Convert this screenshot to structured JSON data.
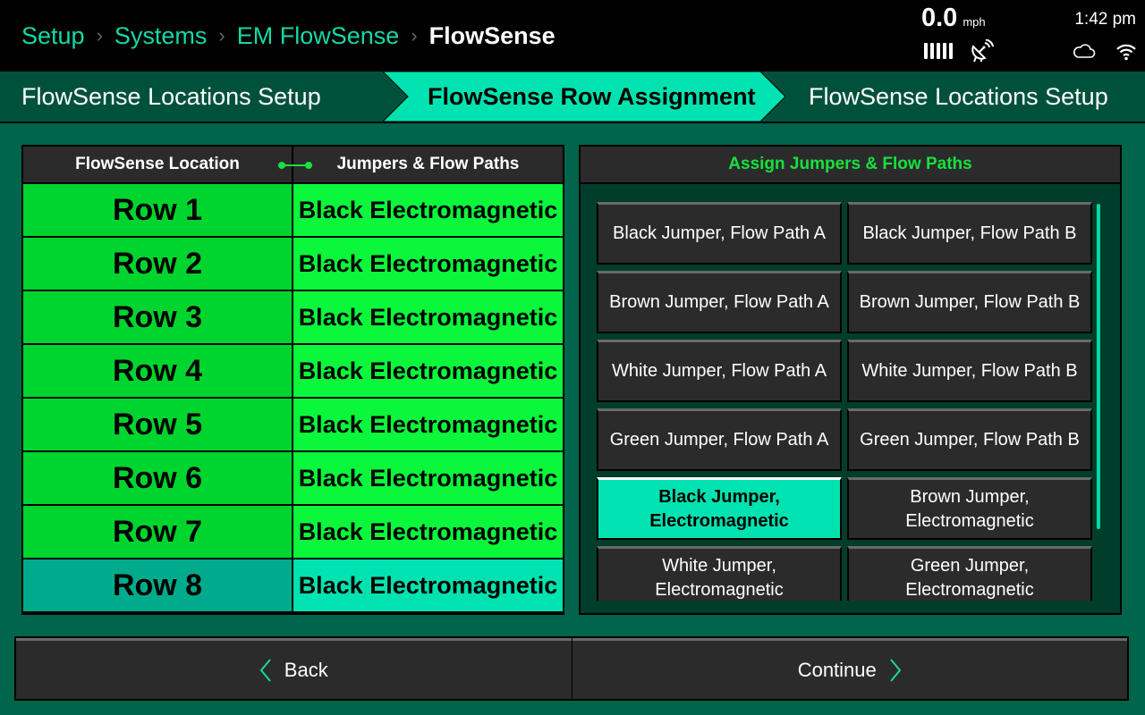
{
  "breadcrumb": {
    "items": [
      "Setup",
      "Systems",
      "EM FlowSense"
    ],
    "current": "FlowSense",
    "separator": "›"
  },
  "status": {
    "speed_value": "0.0",
    "speed_unit": "mph",
    "time": "1:42 pm",
    "icons": [
      "signal-bars-icon",
      "satellite-dish-icon",
      "cloud-icon",
      "wifi-icon"
    ]
  },
  "stepper": {
    "steps": [
      {
        "label": "FlowSense Locations Setup",
        "state": "previous"
      },
      {
        "label": "FlowSense Row Assignment",
        "state": "active"
      },
      {
        "label": "FlowSense Locations Setup",
        "state": "next"
      }
    ]
  },
  "table": {
    "headers": [
      "FlowSense Location",
      "Jumpers & Flow Paths"
    ],
    "rows": [
      {
        "location": "Row 1",
        "assignment": "Black Electromagnetic"
      },
      {
        "location": "Row 2",
        "assignment": "Black Electromagnetic"
      },
      {
        "location": "Row 3",
        "assignment": "Black Electromagnetic"
      },
      {
        "location": "Row 4",
        "assignment": "Black Electromagnetic"
      },
      {
        "location": "Row 5",
        "assignment": "Black Electromagnetic"
      },
      {
        "location": "Row 6",
        "assignment": "Black Electromagnetic"
      },
      {
        "location": "Row 7",
        "assignment": "Black Electromagnetic"
      },
      {
        "location": "Row 8",
        "assignment": "Black Electromagnetic"
      }
    ],
    "selected_row": "Row 8"
  },
  "assign_panel": {
    "title": "Assign Jumpers & Flow Paths",
    "options": [
      "Black Jumper, Flow Path A",
      "Black Jumper, Flow Path B",
      "Brown Jumper, Flow Path A",
      "Brown Jumper, Flow Path B",
      "White Jumper, Flow Path A",
      "White Jumper, Flow Path B",
      "Green Jumper, Flow Path A",
      "Green Jumper, Flow Path B",
      "Black Jumper, Electromagnetic",
      "Brown Jumper, Electromagnetic",
      "White Jumper, Electromagnetic",
      "Green Jumper, Electromagnetic"
    ],
    "selected_option": "Black Jumper, Electromagnetic"
  },
  "footer": {
    "back_label": "Back",
    "continue_label": "Continue"
  },
  "colors": {
    "accent": "#00e3b0",
    "breadcrumb": "#14d9a7",
    "row_location": "#00d42e",
    "row_assignment": "#0bf73c",
    "panel_title": "#16e23c",
    "background": "#00654a"
  }
}
